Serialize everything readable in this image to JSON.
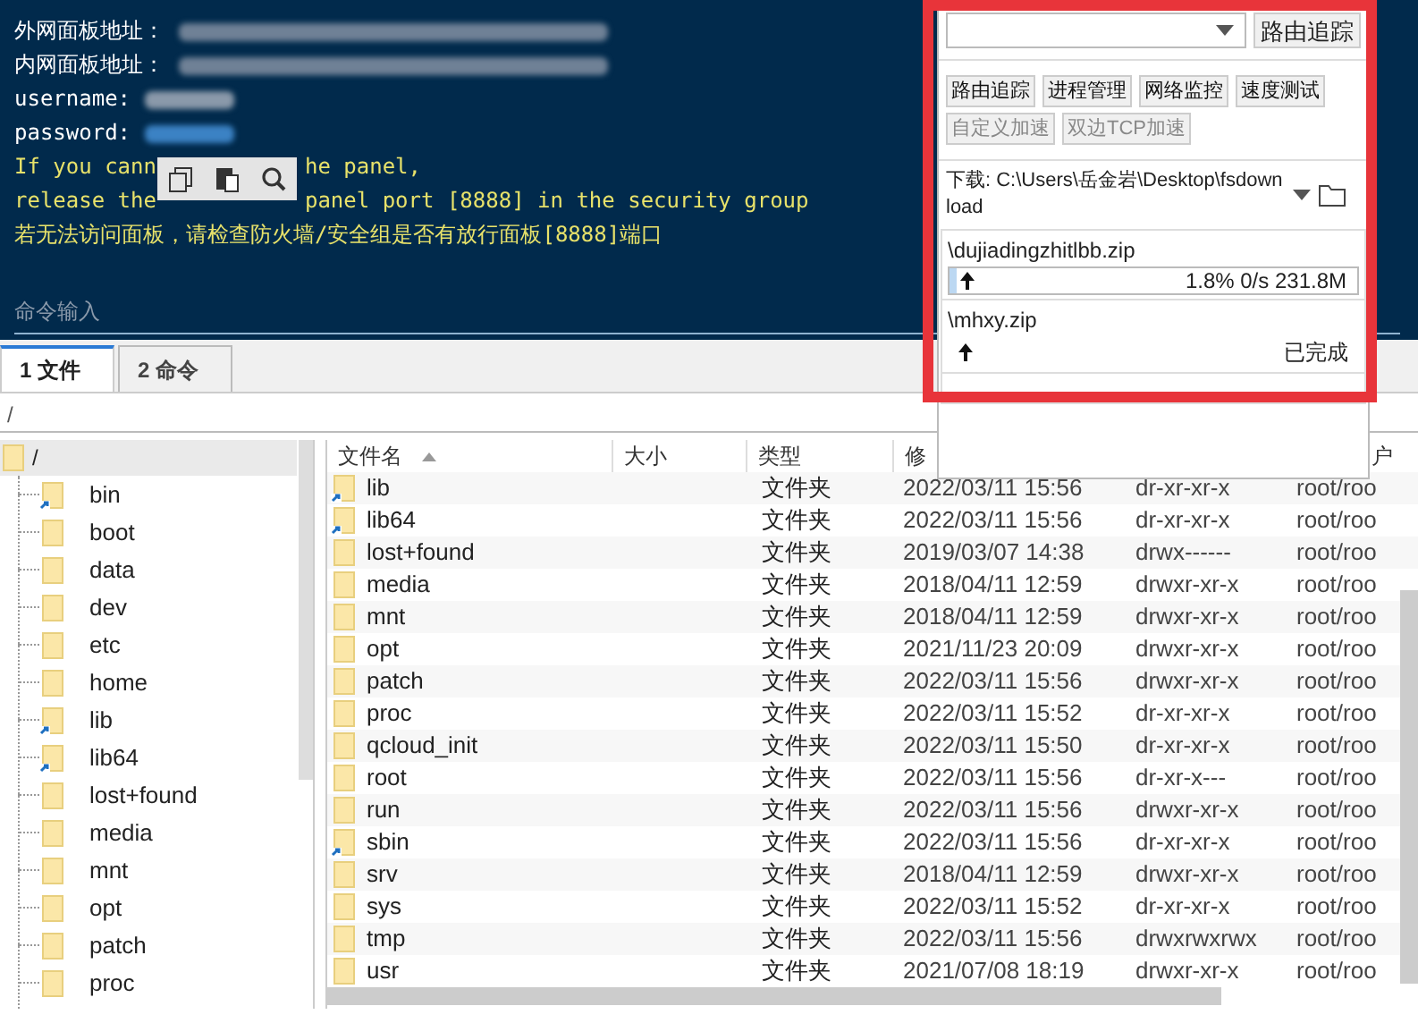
{
  "terminal": {
    "lines": [
      {
        "kind": "label",
        "text": "外网面板地址："
      },
      {
        "kind": "label",
        "text": "内网面板地址："
      },
      {
        "kind": "label",
        "text": "username:"
      },
      {
        "kind": "label",
        "text": "password:"
      },
      {
        "kind": "warn",
        "parts": [
          "If you cann",
          "he panel,"
        ]
      },
      {
        "kind": "warn",
        "parts": [
          "release the",
          "panel port [8888] in the security group"
        ]
      },
      {
        "kind": "warn",
        "parts": [
          "若无法访问面板，请检查防火墙/安全组是否有放行面板[8888]端口"
        ]
      }
    ],
    "input_placeholder": "命令输入"
  },
  "tabs": [
    {
      "label": "1 文件",
      "selected": true
    },
    {
      "label": "2 命令",
      "selected": false
    }
  ],
  "path": "/",
  "tree": {
    "label": "/",
    "selected": true,
    "children": [
      {
        "label": "bin",
        "link": true
      },
      {
        "label": "boot",
        "link": false
      },
      {
        "label": "data",
        "link": false
      },
      {
        "label": "dev",
        "link": false
      },
      {
        "label": "etc",
        "link": false
      },
      {
        "label": "home",
        "link": false
      },
      {
        "label": "lib",
        "link": true
      },
      {
        "label": "lib64",
        "link": true
      },
      {
        "label": "lost+found",
        "link": false
      },
      {
        "label": "media",
        "link": false
      },
      {
        "label": "mnt",
        "link": false
      },
      {
        "label": "opt",
        "link": false
      },
      {
        "label": "patch",
        "link": false
      },
      {
        "label": "proc",
        "link": false
      }
    ]
  },
  "table": {
    "columns": [
      "文件名",
      "大小",
      "类型",
      "修",
      "户"
    ],
    "rows": [
      {
        "name": "lib",
        "link": true,
        "type": "文件夹",
        "modified": "2022/03/11 15:56",
        "perms": "dr-xr-xr-x",
        "owner": "root/roo"
      },
      {
        "name": "lib64",
        "link": true,
        "type": "文件夹",
        "modified": "2022/03/11 15:56",
        "perms": "dr-xr-xr-x",
        "owner": "root/roo"
      },
      {
        "name": "lost+found",
        "link": false,
        "type": "文件夹",
        "modified": "2019/03/07 14:38",
        "perms": "drwx------",
        "owner": "root/roo"
      },
      {
        "name": "media",
        "link": false,
        "type": "文件夹",
        "modified": "2018/04/11 12:59",
        "perms": "drwxr-xr-x",
        "owner": "root/roo"
      },
      {
        "name": "mnt",
        "link": false,
        "type": "文件夹",
        "modified": "2018/04/11 12:59",
        "perms": "drwxr-xr-x",
        "owner": "root/roo"
      },
      {
        "name": "opt",
        "link": false,
        "type": "文件夹",
        "modified": "2021/11/23 20:09",
        "perms": "drwxr-xr-x",
        "owner": "root/roo"
      },
      {
        "name": "patch",
        "link": false,
        "type": "文件夹",
        "modified": "2022/03/11 15:56",
        "perms": "drwxr-xr-x",
        "owner": "root/roo"
      },
      {
        "name": "proc",
        "link": false,
        "type": "文件夹",
        "modified": "2022/03/11 15:52",
        "perms": "dr-xr-xr-x",
        "owner": "root/roo"
      },
      {
        "name": "qcloud_init",
        "link": false,
        "type": "文件夹",
        "modified": "2022/03/11 15:50",
        "perms": "dr-xr-xr-x",
        "owner": "root/roo"
      },
      {
        "name": "root",
        "link": false,
        "type": "文件夹",
        "modified": "2022/03/11 15:56",
        "perms": "dr-xr-x---",
        "owner": "root/roo"
      },
      {
        "name": "run",
        "link": false,
        "type": "文件夹",
        "modified": "2022/03/11 15:56",
        "perms": "drwxr-xr-x",
        "owner": "root/roo"
      },
      {
        "name": "sbin",
        "link": true,
        "type": "文件夹",
        "modified": "2022/03/11 15:56",
        "perms": "dr-xr-xr-x",
        "owner": "root/roo"
      },
      {
        "name": "srv",
        "link": false,
        "type": "文件夹",
        "modified": "2018/04/11 12:59",
        "perms": "drwxr-xr-x",
        "owner": "root/roo"
      },
      {
        "name": "sys",
        "link": false,
        "type": "文件夹",
        "modified": "2022/03/11 15:52",
        "perms": "dr-xr-xr-x",
        "owner": "root/roo"
      },
      {
        "name": "tmp",
        "link": false,
        "type": "文件夹",
        "modified": "2022/03/11 15:56",
        "perms": "drwxrwxrwx",
        "owner": "root/roo"
      },
      {
        "name": "usr",
        "link": false,
        "type": "文件夹",
        "modified": "2021/07/08 18:19",
        "perms": "drwxr-xr-x",
        "owner": "root/roo"
      }
    ]
  },
  "tools_panel": {
    "trace_button": "路由追踪",
    "buttons": [
      {
        "label": "路由追踪",
        "disabled": false
      },
      {
        "label": "进程管理",
        "disabled": false
      },
      {
        "label": "网络监控",
        "disabled": false
      },
      {
        "label": "速度测试",
        "disabled": false
      },
      {
        "label": "自定义加速",
        "disabled": true
      },
      {
        "label": "双边TCP加速",
        "disabled": true
      }
    ],
    "download_path": "下载: C:\\Users\\岳金岩\\Desktop\\fsdownload",
    "transfers": [
      {
        "name": "\\dujiadingzhitlbb.zip",
        "level": 0.018,
        "status": "1.8% 0/s 231.8M",
        "done": false
      },
      {
        "name": "\\mhxy.zip",
        "status": "已完成",
        "done": true
      }
    ]
  }
}
